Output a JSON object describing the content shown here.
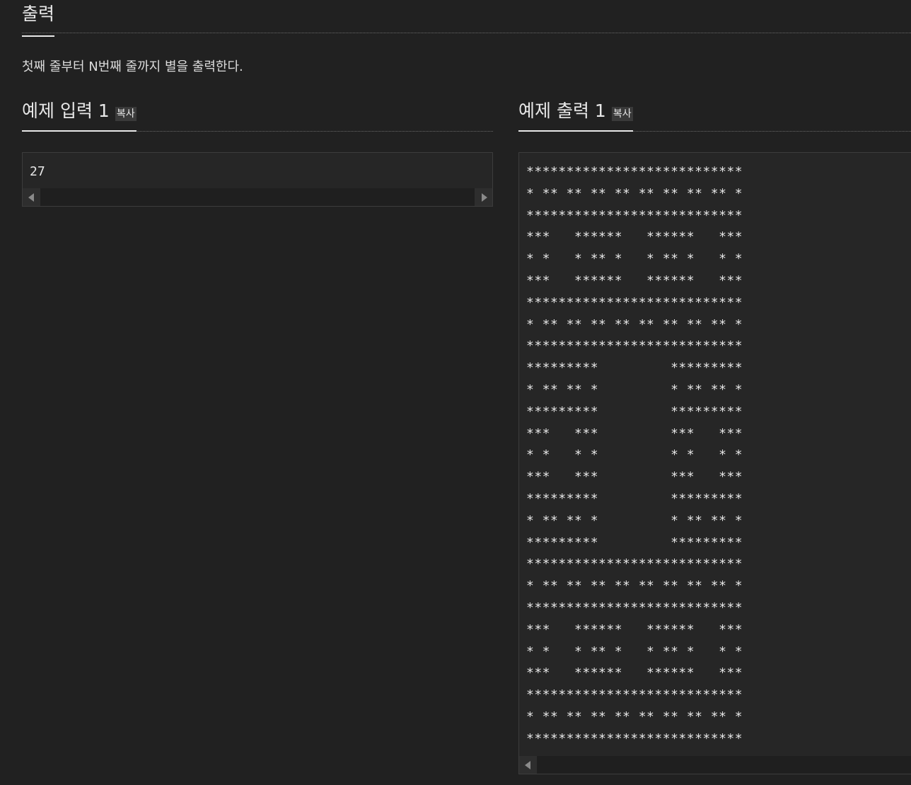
{
  "output_section": {
    "title": "출력",
    "description": "첫째 줄부터 N번째 줄까지 별을 출력한다."
  },
  "sample_input": {
    "title": "예제 입력 1",
    "copy_label": "복사",
    "content": "27"
  },
  "sample_output": {
    "title": "예제 출력 1",
    "copy_label": "복사",
    "lines": [
      "***************************",
      "* ** ** ** ** ** ** ** ** *",
      "***************************",
      "***   ******   ******   ***",
      "* *   * ** *   * ** *   * *",
      "***   ******   ******   ***",
      "***************************",
      "* ** ** ** ** ** ** ** ** *",
      "***************************",
      "*********         *********",
      "* ** ** *         * ** ** *",
      "*********         *********",
      "***   ***         ***   ***",
      "* *   * *         * *   * *",
      "***   ***         ***   ***",
      "*********         *********",
      "* ** ** *         * ** ** *",
      "*********         *********",
      "***************************",
      "* ** ** ** ** ** ** ** ** *",
      "***************************",
      "***   ******   ******   ***",
      "* *   * ** *   * ** *   * *",
      "***   ******   ******   ***",
      "***************************",
      "* ** ** ** ** ** ** ** ** *",
      "***************************"
    ]
  }
}
